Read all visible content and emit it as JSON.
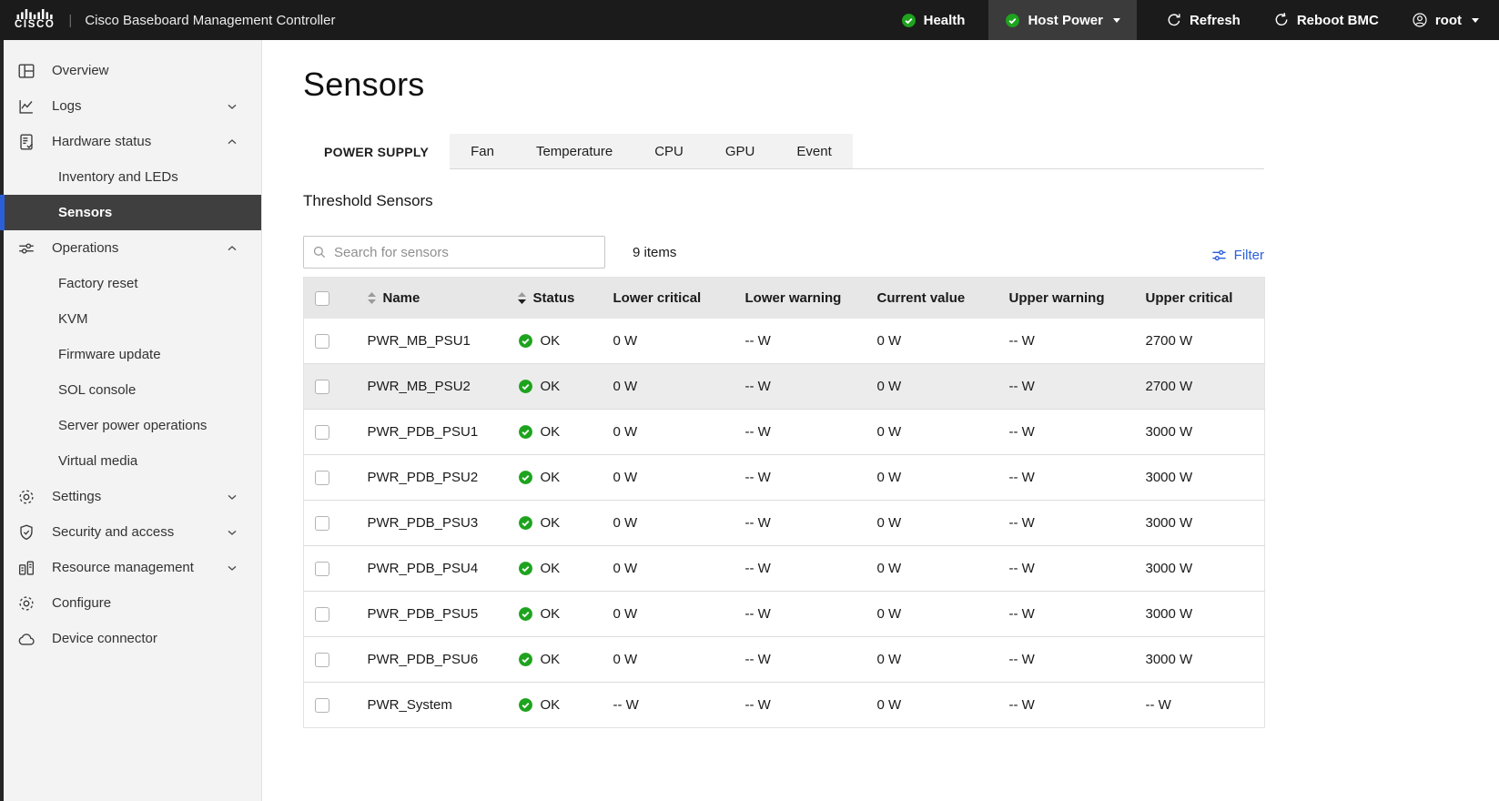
{
  "topbar": {
    "brand": "cisco",
    "app_title": "Cisco Baseboard Management Controller",
    "health_label": "Health",
    "host_power_label": "Host Power",
    "refresh_label": "Refresh",
    "reboot_label": "Reboot BMC",
    "user_label": "root"
  },
  "sidebar": {
    "items": [
      {
        "label": "Overview",
        "icon": "overview-icon"
      },
      {
        "label": "Logs",
        "icon": "logs-icon",
        "chevron": "down"
      },
      {
        "label": "Hardware status",
        "icon": "hardware-status-icon",
        "chevron": "up"
      },
      {
        "label": "Inventory and LEDs",
        "child": true
      },
      {
        "label": "Sensors",
        "child": true,
        "selected": true
      },
      {
        "label": "Operations",
        "icon": "operations-icon",
        "chevron": "up"
      },
      {
        "label": "Factory reset",
        "child": true
      },
      {
        "label": "KVM",
        "child": true
      },
      {
        "label": "Firmware update",
        "child": true
      },
      {
        "label": "SOL console",
        "child": true
      },
      {
        "label": "Server power operations",
        "child": true
      },
      {
        "label": "Virtual media",
        "child": true
      },
      {
        "label": "Settings",
        "icon": "settings-icon",
        "chevron": "down"
      },
      {
        "label": "Security and access",
        "icon": "security-icon",
        "chevron": "down"
      },
      {
        "label": "Resource management",
        "icon": "resource-icon",
        "chevron": "down"
      },
      {
        "label": "Configure",
        "icon": "configure-icon"
      },
      {
        "label": "Device connector",
        "icon": "cloud-icon"
      }
    ]
  },
  "main": {
    "page_title": "Sensors",
    "tabs": [
      {
        "label": "POWER SUPPLY",
        "active": true
      },
      {
        "label": "Fan"
      },
      {
        "label": "Temperature"
      },
      {
        "label": "CPU"
      },
      {
        "label": "GPU"
      },
      {
        "label": "Event"
      }
    ],
    "section_title": "Threshold Sensors",
    "toolbar": {
      "search_placeholder": "Search for sensors",
      "items_count": "9 items",
      "filter_label": "Filter"
    },
    "table": {
      "columns": [
        "Name",
        "Status",
        "Lower critical",
        "Lower warning",
        "Current value",
        "Upper warning",
        "Upper critical"
      ],
      "rows": [
        {
          "name": "PWR_MB_PSU1",
          "status": "OK",
          "lower_critical": "0 W",
          "lower_warning": "-- W",
          "current_value": "0 W",
          "upper_warning": "-- W",
          "upper_critical": "2700 W"
        },
        {
          "name": "PWR_MB_PSU2",
          "status": "OK",
          "lower_critical": "0 W",
          "lower_warning": "-- W",
          "current_value": "0 W",
          "upper_warning": "-- W",
          "upper_critical": "2700 W",
          "highlighted": true
        },
        {
          "name": "PWR_PDB_PSU1",
          "status": "OK",
          "lower_critical": "0 W",
          "lower_warning": "-- W",
          "current_value": "0 W",
          "upper_warning": "-- W",
          "upper_critical": "3000 W"
        },
        {
          "name": "PWR_PDB_PSU2",
          "status": "OK",
          "lower_critical": "0 W",
          "lower_warning": "-- W",
          "current_value": "0 W",
          "upper_warning": "-- W",
          "upper_critical": "3000 W"
        },
        {
          "name": "PWR_PDB_PSU3",
          "status": "OK",
          "lower_critical": "0 W",
          "lower_warning": "-- W",
          "current_value": "0 W",
          "upper_warning": "-- W",
          "upper_critical": "3000 W"
        },
        {
          "name": "PWR_PDB_PSU4",
          "status": "OK",
          "lower_critical": "0 W",
          "lower_warning": "-- W",
          "current_value": "0 W",
          "upper_warning": "-- W",
          "upper_critical": "3000 W"
        },
        {
          "name": "PWR_PDB_PSU5",
          "status": "OK",
          "lower_critical": "0 W",
          "lower_warning": "-- W",
          "current_value": "0 W",
          "upper_warning": "-- W",
          "upper_critical": "3000 W"
        },
        {
          "name": "PWR_PDB_PSU6",
          "status": "OK",
          "lower_critical": "0 W",
          "lower_warning": "-- W",
          "current_value": "0 W",
          "upper_warning": "-- W",
          "upper_critical": "3000 W"
        },
        {
          "name": "PWR_System",
          "status": "OK",
          "lower_critical": "-- W",
          "lower_warning": "-- W",
          "current_value": "0 W",
          "upper_warning": "-- W",
          "upper_critical": "-- W"
        }
      ]
    }
  },
  "colors": {
    "accent_blue": "#2b5fd9",
    "status_green": "#1ea31e",
    "topbar_bg": "#1b1b1b",
    "selected_item_bg": "#3f3f3f"
  }
}
